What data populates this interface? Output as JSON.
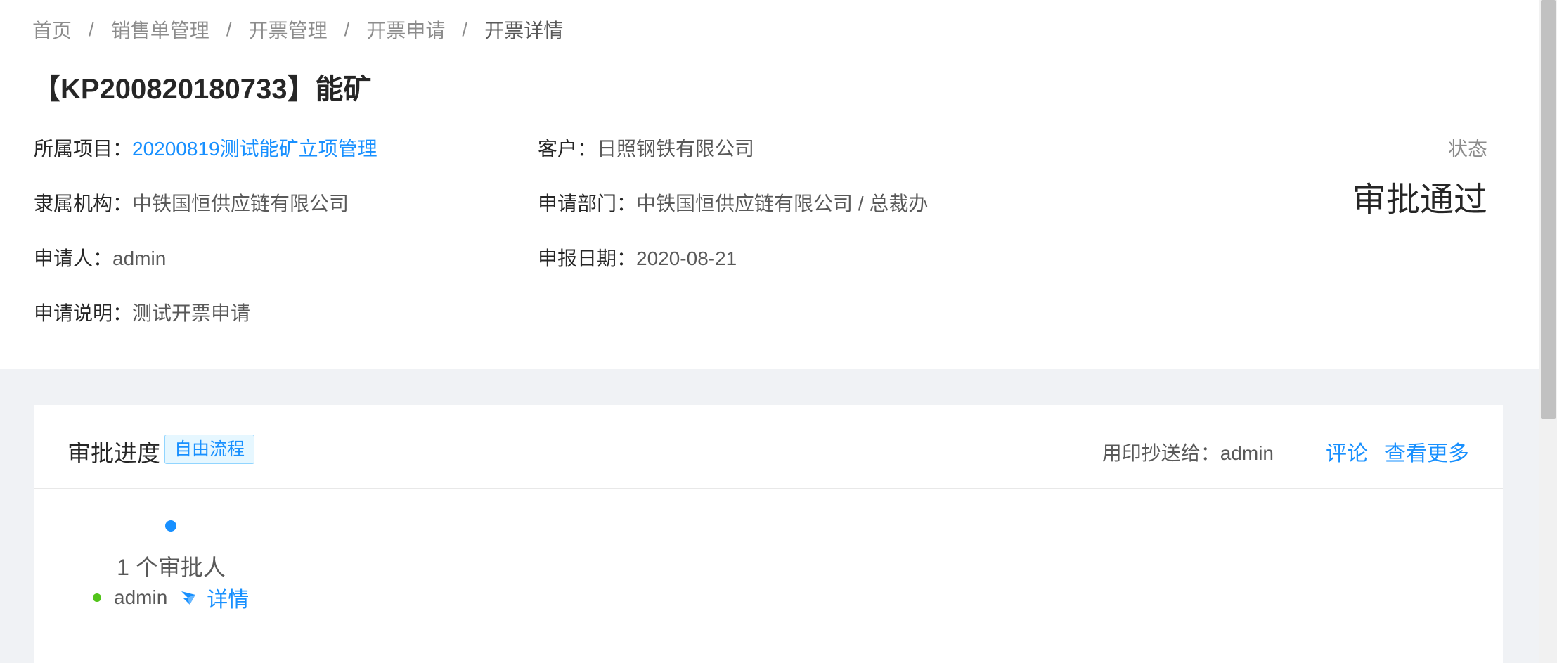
{
  "breadcrumb": [
    "首页",
    "销售单管理",
    "开票管理",
    "开票申请",
    "开票详情"
  ],
  "breadcrumb_separator": "/",
  "page_title": "【KP200820180733】能矿",
  "fields": {
    "project": {
      "label": "所属项目：",
      "value": "20200819测试能矿立项管理"
    },
    "customer": {
      "label": "客户：",
      "value": "日照钢铁有限公司"
    },
    "org": {
      "label": "隶属机构：",
      "value": "中铁国恒供应链有限公司"
    },
    "department": {
      "label": "申请部门：",
      "value": "中铁国恒供应链有限公司 / 总裁办"
    },
    "applicant": {
      "label": "申请人：",
      "value": "admin"
    },
    "report_date": {
      "label": "申报日期：",
      "value": "2020-08-21"
    },
    "description": {
      "label": "申请说明：",
      "value": "测试开票申请"
    }
  },
  "status": {
    "label": "状态",
    "value": "审批通过"
  },
  "approval": {
    "title": "审批进度",
    "flow_tag": "自由流程",
    "cc_text": "用印抄送给：admin",
    "comment_label": "评论",
    "more_label": "查看更多",
    "step": {
      "count_text": "1 个审批人",
      "approver_name": "admin",
      "approver_online": true,
      "detail_label": "详情"
    }
  },
  "colors": {
    "link": "#1890ff",
    "online": "#52c41a",
    "tag_bg": "#e6f7ff",
    "tag_border": "#91d5ff",
    "page_bg": "#f0f2f5"
  },
  "icons": {
    "send": "paper-plane-icon"
  }
}
